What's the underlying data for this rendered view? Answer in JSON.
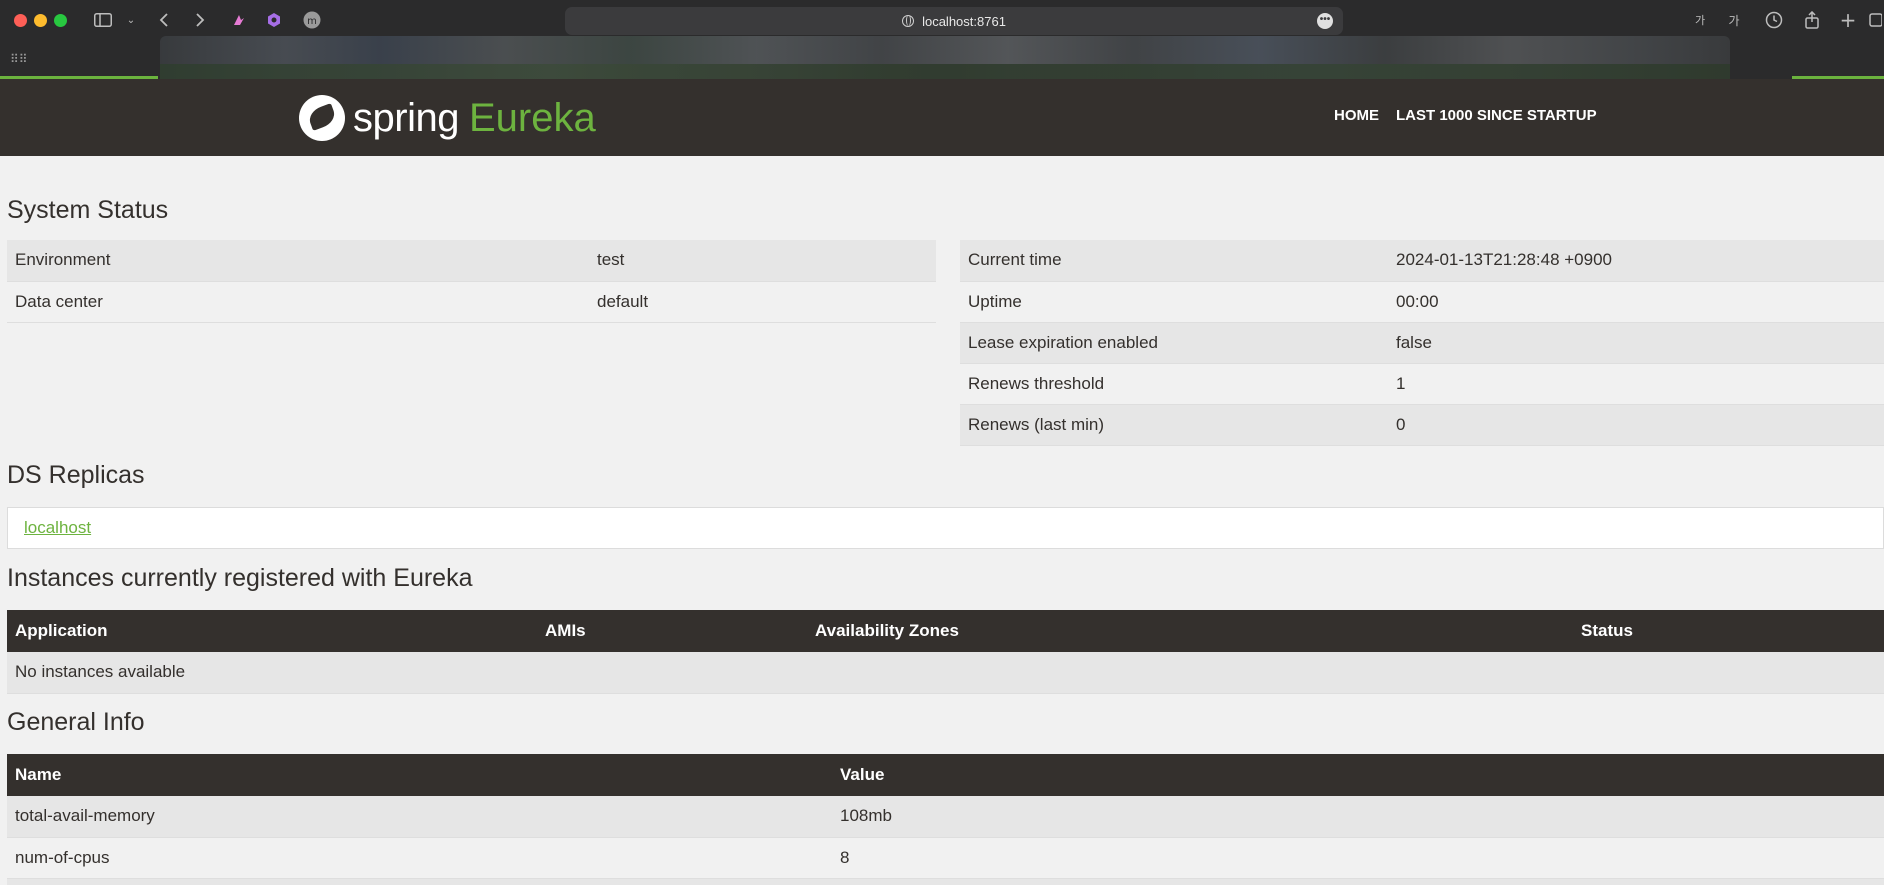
{
  "browser": {
    "url": "localhost:8761",
    "toolbar_text_1": "가",
    "toolbar_text_2": "가"
  },
  "header": {
    "logo_spring": "spring",
    "logo_eureka": "Eureka",
    "nav": [
      "HOME",
      "LAST 1000 SINCE STARTUP"
    ],
    "colors": {
      "bar": "#34302d",
      "accent": "#6db33f"
    }
  },
  "system_status": {
    "title": "System Status",
    "left": [
      {
        "label": "Environment",
        "value": "test"
      },
      {
        "label": "Data center",
        "value": "default"
      }
    ],
    "right": [
      {
        "label": "Current time",
        "value": "2024-01-13T21:28:48 +0900"
      },
      {
        "label": "Uptime",
        "value": "00:00"
      },
      {
        "label": "Lease expiration enabled",
        "value": "false"
      },
      {
        "label": "Renews threshold",
        "value": "1"
      },
      {
        "label": "Renews (last min)",
        "value": "0"
      }
    ]
  },
  "ds_replicas": {
    "title": "DS Replicas",
    "link": "localhost"
  },
  "instances": {
    "title": "Instances currently registered with Eureka",
    "columns": [
      "Application",
      "AMIs",
      "Availability Zones",
      "Status"
    ],
    "empty_text": "No instances available"
  },
  "general_info": {
    "title": "General Info",
    "columns": [
      "Name",
      "Value"
    ],
    "rows": [
      {
        "name": "total-avail-memory",
        "value": "108mb"
      },
      {
        "name": "num-of-cpus",
        "value": "8"
      }
    ]
  }
}
